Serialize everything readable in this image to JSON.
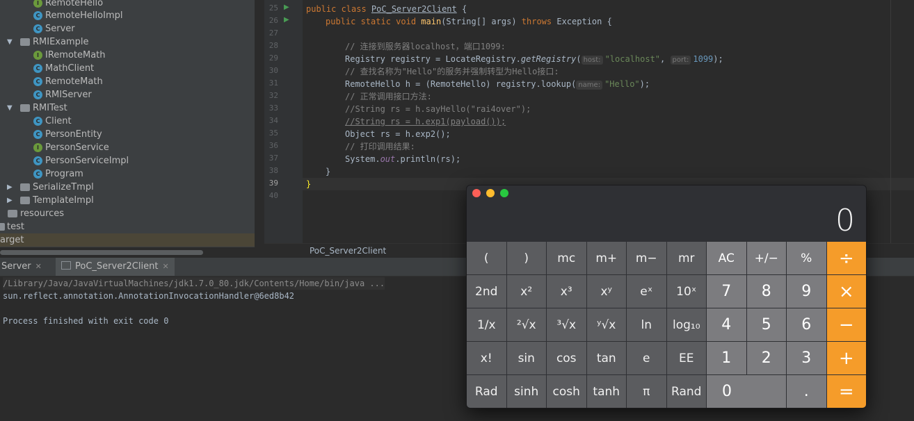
{
  "project_tree": {
    "items": [
      {
        "label": "RemoteHello",
        "kind": "iface",
        "icon": "interface-icon"
      },
      {
        "label": "RemoteHelloImpl",
        "kind": "class",
        "icon": "class-icon"
      },
      {
        "label": "Server",
        "kind": "class",
        "icon": "class-icon"
      },
      {
        "label": "RMIExample",
        "kind": "folder",
        "icon": "package-icon",
        "expanded": true
      },
      {
        "label": "IRemoteMath",
        "kind": "iface",
        "icon": "interface-icon"
      },
      {
        "label": "MathClient",
        "kind": "class",
        "icon": "class-icon"
      },
      {
        "label": "RemoteMath",
        "kind": "class",
        "icon": "class-icon"
      },
      {
        "label": "RMIServer",
        "kind": "class",
        "icon": "class-icon"
      },
      {
        "label": "RMITest",
        "kind": "folder",
        "icon": "package-icon",
        "expanded": true
      },
      {
        "label": "Client",
        "kind": "class",
        "icon": "class-icon"
      },
      {
        "label": "PersonEntity",
        "kind": "class",
        "icon": "class-icon"
      },
      {
        "label": "PersonService",
        "kind": "iface",
        "icon": "interface-icon"
      },
      {
        "label": "PersonServiceImpl",
        "kind": "class",
        "icon": "class-icon"
      },
      {
        "label": "Program",
        "kind": "class",
        "icon": "class-icon"
      },
      {
        "label": "SerializeTmpl",
        "kind": "folder",
        "icon": "package-icon",
        "expanded": false
      },
      {
        "label": "TemplateImpl",
        "kind": "folder",
        "icon": "package-icon",
        "expanded": false
      },
      {
        "label": "resources",
        "kind": "folder",
        "icon": "resources-folder-icon"
      },
      {
        "label": "test",
        "kind": "folder",
        "icon": "folder-icon"
      },
      {
        "label": "arget",
        "kind": "folder",
        "icon": "folder-icon"
      }
    ]
  },
  "editor": {
    "line_numbers": [
      "25",
      "26",
      "27",
      "28",
      "29",
      "30",
      "31",
      "32",
      "33",
      "34",
      "35",
      "36",
      "37",
      "38",
      "39",
      "40"
    ],
    "code": {
      "l25_kw": "public class ",
      "l25_name": "PoC_Server2Client",
      "l25_brace": " {",
      "l26_kw1": "public static void ",
      "l26_fn": "main",
      "l26_args": "(String[] args) ",
      "l26_kw2": "throws ",
      "l26_rest": "Exception {",
      "l28_cmt": "// 连接到服务器localhost，端口1099:",
      "l29_a": "Registry registry = LocateRegistry.",
      "l29_fn": "getRegistry",
      "l29_p": "(",
      "l29_hint1": "host:",
      "l29_str": "\"localhost\"",
      "l29_comma": ", ",
      "l29_hint2": "port:",
      "l29_num": "1099",
      "l29_end": ");",
      "l30_cmt": "// 查找名称为\"Hello\"的服务并强制转型为Hello接口:",
      "l31_a": "RemoteHello h = (RemoteHello) registry.lookup(",
      "l31_hint": "name:",
      "l31_str": "\"Hello\"",
      "l31_end": ");",
      "l32_cmt": "// 正常调用接口方法:",
      "l33_cmt": "//String rs = h.sayHello(\"rai4over\");",
      "l34_cmt": "//String rs = h.exp1(payload());",
      "l35_code": "Object rs = h.exp2();",
      "l36_cmt": "// 打印调用结果:",
      "l37_a": "System.",
      "l37_out": "out",
      "l37_b": ".println(rs);",
      "l38_code": "}",
      "l39_code": "}"
    },
    "breadcrumb": "PoC_Server2Client"
  },
  "run_panel": {
    "tabs": [
      {
        "label": "Server",
        "active": false
      },
      {
        "label": "PoC_Server2Client",
        "active": true
      }
    ],
    "console_lines": [
      "/Library/Java/JavaVirtualMachines/jdk1.7.0_80.jdk/Contents/Home/bin/java ...",
      "sun.reflect.annotation.AnnotationInvocationHandler@6ed8b42",
      "",
      "Process finished with exit code 0"
    ]
  },
  "calculator": {
    "display": "0",
    "traffic_lights": {
      "close": "#fd5f57",
      "minimize": "#febc2e",
      "zoom": "#28c840"
    },
    "rows": [
      [
        "(",
        ")",
        "mc",
        "m+",
        "m−",
        "mr",
        "AC",
        "+/−",
        "%",
        "÷"
      ],
      [
        "2nd",
        "x²",
        "x³",
        "xʸ",
        "eˣ",
        "10ˣ",
        "7",
        "8",
        "9",
        "×"
      ],
      [
        "1/x",
        "²√x",
        "³√x",
        "ʸ√x",
        "ln",
        "log₁₀",
        "4",
        "5",
        "6",
        "−"
      ],
      [
        "x!",
        "sin",
        "cos",
        "tan",
        "e",
        "EE",
        "1",
        "2",
        "3",
        "+"
      ],
      [
        "Rad",
        "sinh",
        "cosh",
        "tanh",
        "π",
        "Rand",
        "0",
        ".",
        "="
      ]
    ],
    "colors": {
      "function_key": "#5b5c5f",
      "digit_key": "#7c7c7f",
      "operator_key": "#f59c2a"
    }
  }
}
